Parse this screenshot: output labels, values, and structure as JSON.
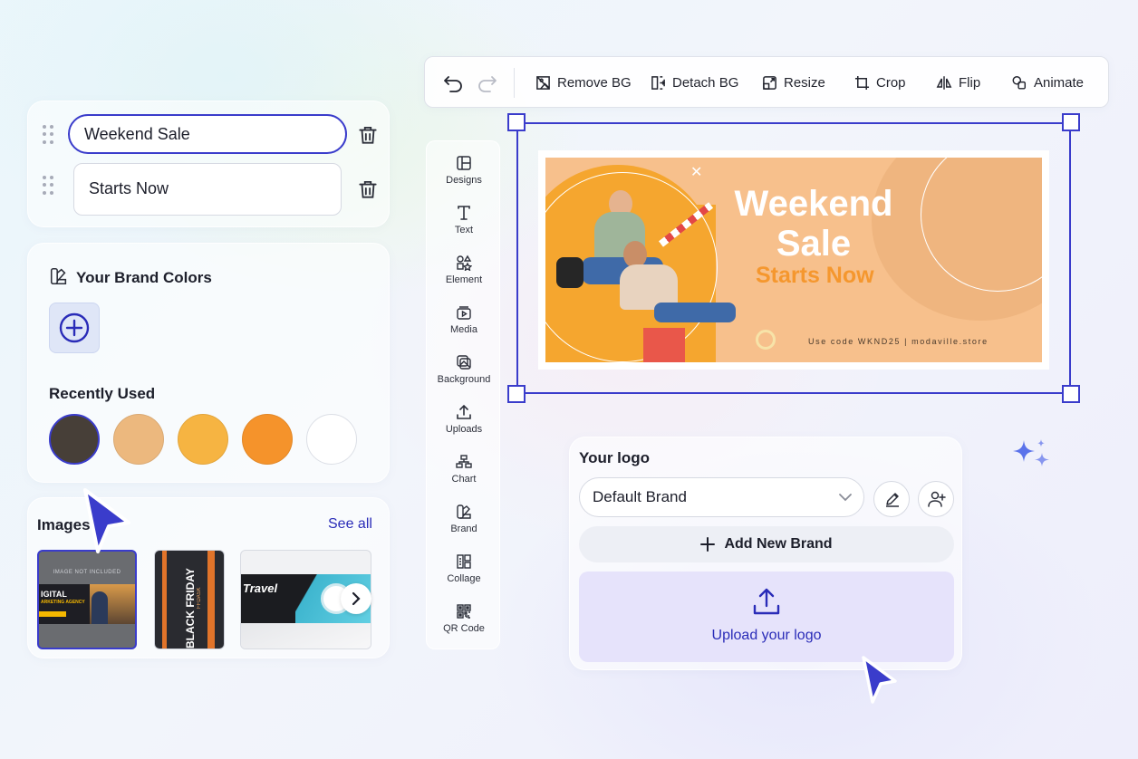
{
  "text_layers": [
    {
      "value": "Weekend Sale"
    },
    {
      "value": "Starts Now"
    }
  ],
  "brand_colors": {
    "title": "Your Brand Colors",
    "recent_title": "Recently Used",
    "recent_colors": [
      "#473f38",
      "#ecb87e",
      "#f6b442",
      "#f5932b",
      "#ffffff"
    ]
  },
  "images": {
    "title": "Images",
    "see_all": "See all",
    "thumb1_top": "IMAGE NOT INCLUDED",
    "thumb1_line1": "IGITAL",
    "thumb1_line2": "ARKETING AGENCY",
    "thumb2_text": "BLACK FRIDAY",
    "thumb2_sub": "FFDASK",
    "thumb3_text": "Travel"
  },
  "toolbar": {
    "remove_bg": "Remove BG",
    "detach_bg": "Detach BG",
    "resize": "Resize",
    "crop": "Crop",
    "flip": "Flip",
    "animate": "Animate"
  },
  "sidenav": {
    "items": [
      "Designs",
      "Text",
      "Element",
      "Media",
      "Background",
      "Uploads",
      "Chart",
      "Brand",
      "Collage",
      "QR Code"
    ]
  },
  "banner": {
    "headline1": "Weekend",
    "headline2": "Sale",
    "subhead": "Starts Now",
    "footer": "Use code WKND25 | modaville.store"
  },
  "logo": {
    "title": "Your logo",
    "selected_brand": "Default Brand",
    "add_brand": "Add New Brand",
    "upload": "Upload your logo"
  },
  "colors": {
    "accent": "#3a3ccb",
    "banner_bg": "#f7c08c",
    "banner_orange": "#f5972e"
  }
}
